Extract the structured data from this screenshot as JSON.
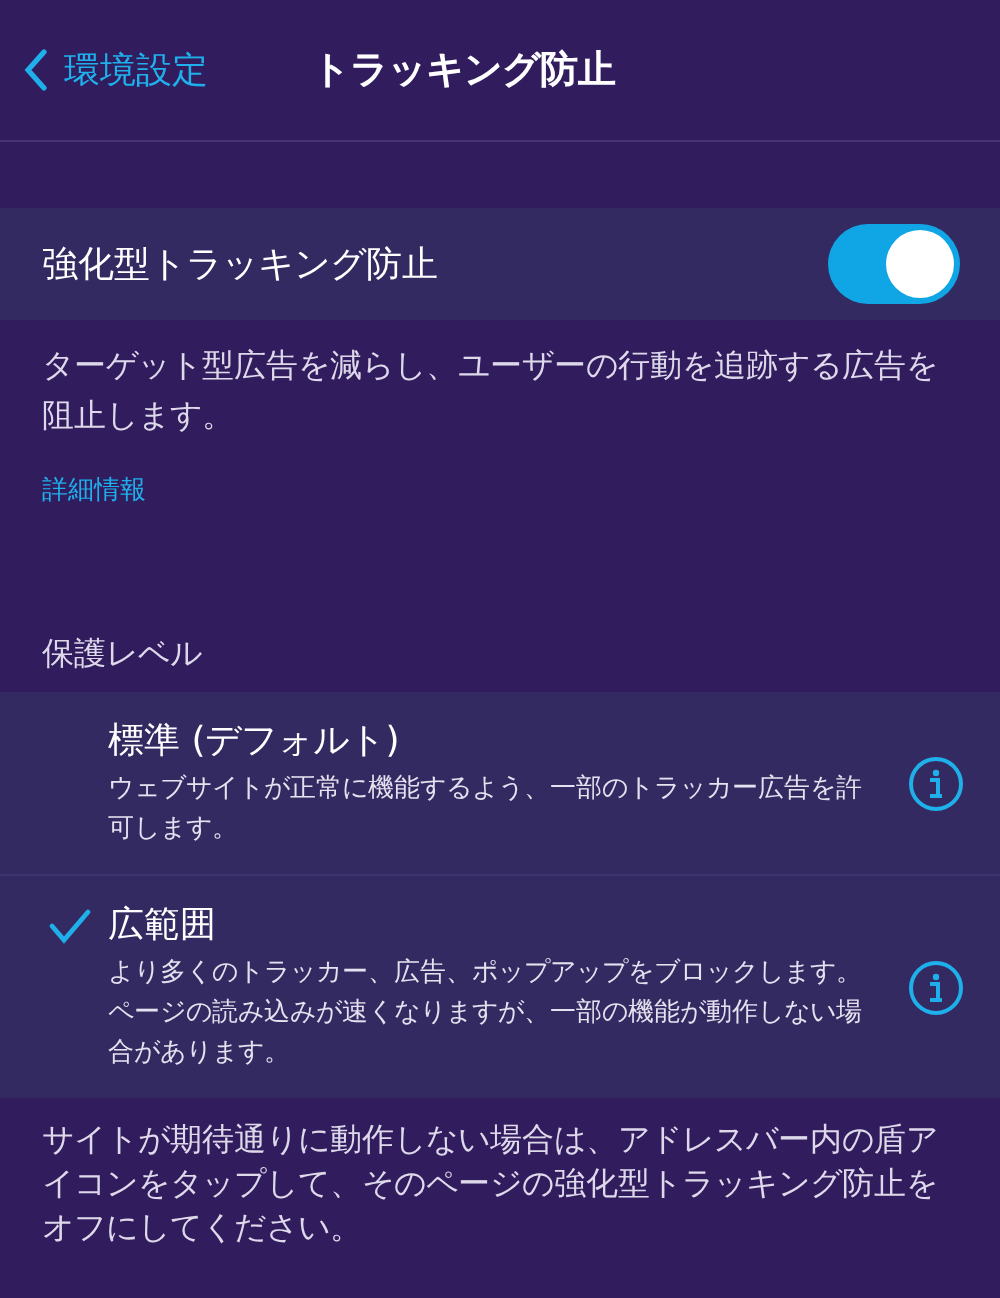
{
  "nav": {
    "back": "環境設定",
    "title": "トラッキング防止"
  },
  "enhanced": {
    "label": "強化型トラッキング防止",
    "on": true,
    "description": "ターゲット型広告を減らし、ユーザーの行動を追跡する広告を阻止します。",
    "link": "詳細情報"
  },
  "protection": {
    "heading": "保護レベル",
    "options": [
      {
        "title": "標準 (デフォルト)",
        "description": "ウェブサイトが正常に機能するよう、一部のトラッカー広告を許可します。",
        "selected": false
      },
      {
        "title": "広範囲",
        "description": "より多くのトラッカー、広告、ポップアップをブロックします。ページの読み込みが速くなりますが、一部の機能が動作しない場合があります。",
        "selected": true
      }
    ]
  },
  "footer": "サイトが期待通りに動作しない場合は、アドレスバー内の盾アイコンをタップして、そのページの強化型トラッキング防止をオフにしてください。"
}
